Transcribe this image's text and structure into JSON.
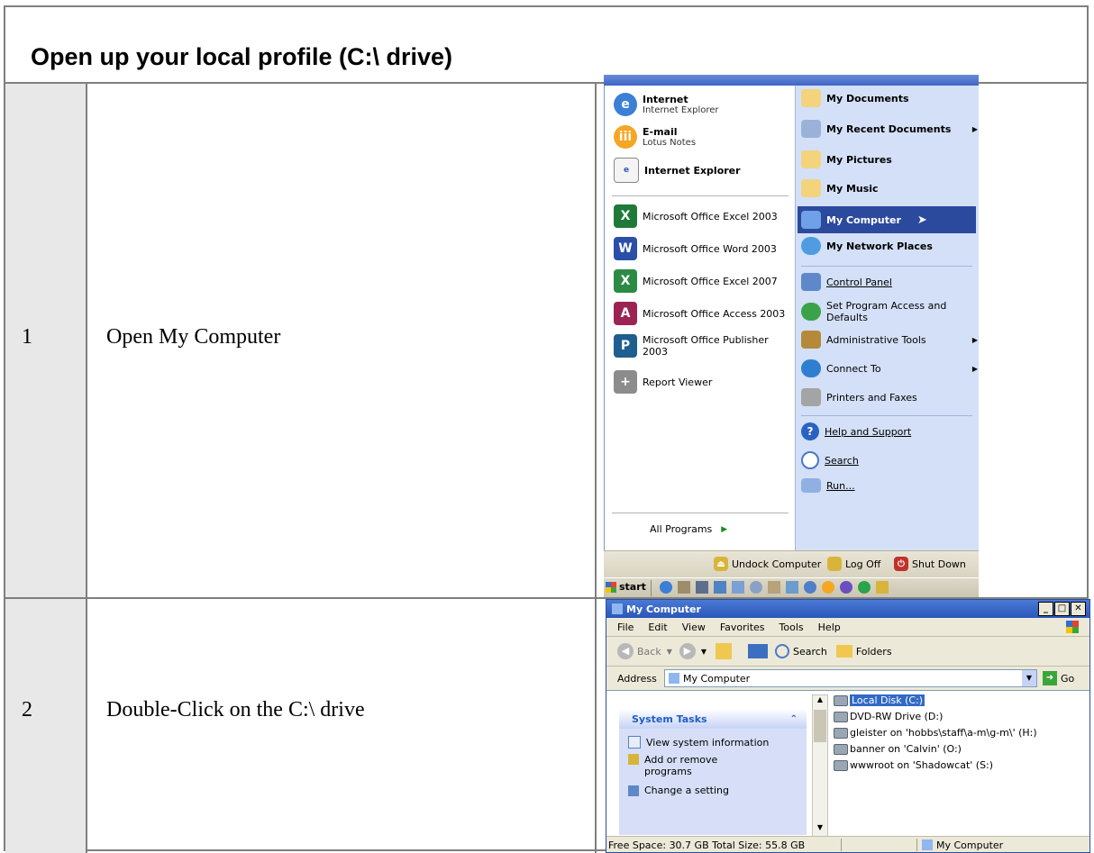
{
  "doc": {
    "title": "Open up your local profile (C:\\ drive)",
    "steps": [
      {
        "num": "1",
        "text": "Open My Computer"
      },
      {
        "num": "2",
        "text": "Double-Click on the C:\\ drive"
      }
    ]
  },
  "start_menu": {
    "left_items": [
      {
        "title": "Internet",
        "subtitle": "Internet Explorer",
        "icon": "internet-explorer-icon"
      },
      {
        "title": "E-mail",
        "subtitle": "Lotus Notes",
        "icon": "lotus-notes-icon"
      },
      {
        "title": "Internet Explorer",
        "icon": "internet-explorer-page-icon"
      },
      {
        "title": "Microsoft Office Excel 2003",
        "icon": "excel-icon"
      },
      {
        "title": "Microsoft Office Word 2003",
        "icon": "word-icon"
      },
      {
        "title": "Microsoft Office Excel 2007",
        "icon": "excel-icon"
      },
      {
        "title": "Microsoft Office Access 2003",
        "icon": "access-icon"
      },
      {
        "title": "Microsoft Office Publisher 2003",
        "icon": "publisher-icon"
      },
      {
        "title": "Report Viewer",
        "icon": "report-viewer-icon"
      }
    ],
    "all_programs": "All Programs",
    "right_items": [
      {
        "label": "My Documents",
        "icon": "folder-icon"
      },
      {
        "label": "My Recent Documents",
        "icon": "recent-documents-icon"
      },
      {
        "label": "My Pictures",
        "icon": "folder-icon"
      },
      {
        "label": "My Music",
        "icon": "folder-icon"
      },
      {
        "label": "My Computer",
        "icon": "computer-icon"
      },
      {
        "label": "My Network Places",
        "icon": "network-icon"
      },
      {
        "label": "Control Panel",
        "icon": "control-panel-icon"
      },
      {
        "label": "Set Program Access and Defaults",
        "icon": "program-access-icon"
      },
      {
        "label": "Administrative Tools",
        "icon": "admin-tools-icon"
      },
      {
        "label": "Connect To",
        "icon": "connect-icon"
      },
      {
        "label": "Printers and Faxes",
        "icon": "printer-icon"
      },
      {
        "label": "Help and Support",
        "icon": "help-icon"
      },
      {
        "label": "Search",
        "icon": "search-icon"
      },
      {
        "label": "Run...",
        "icon": "run-icon"
      }
    ],
    "bottom": {
      "undock": "Undock Computer",
      "log_off": "Log Off",
      "shut_down": "Shut Down"
    },
    "taskbar": {
      "start": "start"
    }
  },
  "explorer": {
    "title": "My Computer",
    "menu": [
      "File",
      "Edit",
      "View",
      "Favorites",
      "Tools",
      "Help"
    ],
    "toolbar": {
      "back": "Back",
      "search": "Search",
      "folders": "Folders"
    },
    "address_label": "Address",
    "address_value": "My Computer",
    "go": "Go",
    "tasks_header": "System Tasks",
    "tasks": [
      "View system information",
      "Add or remove programs",
      "Change a setting"
    ],
    "drives": [
      "Local Disk (C:)",
      "DVD-RW Drive (D:)",
      "gleister on 'hobbs\\staff\\a-m\\g-m\\' (H:)",
      "banner on 'Calvin' (O:)",
      "wwwroot on 'Shadowcat' (S:)"
    ],
    "status_left": "Free Space: 30.7 GB Total Size: 55.8 GB",
    "status_right": "My Computer"
  }
}
